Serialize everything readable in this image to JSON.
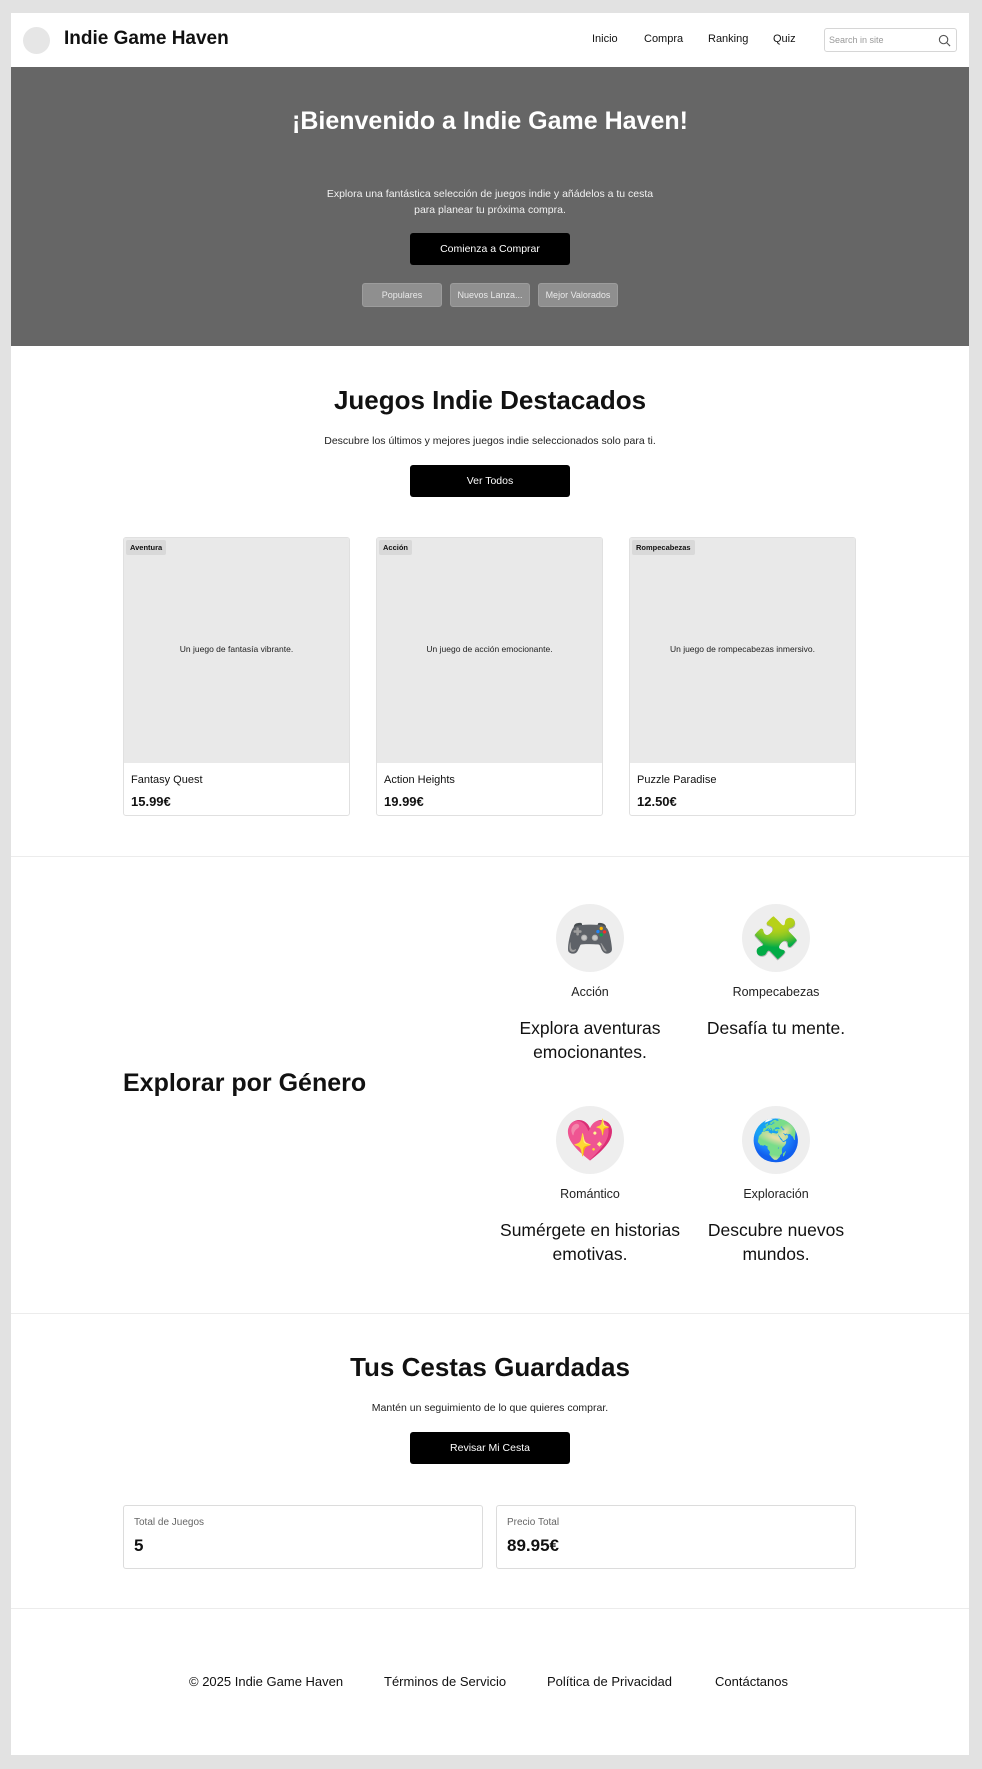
{
  "header": {
    "brand": "Indie Game Haven",
    "nav": [
      "Inicio",
      "Compra",
      "Ranking",
      "Quiz"
    ],
    "search_placeholder": "Search in site"
  },
  "hero": {
    "title": "¡Bienvenido a Indie Game Haven!",
    "subtitle": "Explora una fantástica selección de juegos indie y añádelos a tu cesta para planear tu próxima compra.",
    "cta": "Comienza a Comprar",
    "filters": [
      "Populares",
      "Nuevos Lanza...",
      "Mejor Valorados"
    ]
  },
  "featured": {
    "title": "Juegos Indie Destacados",
    "subtitle": "Descubre los últimos y mejores juegos indie seleccionados solo para ti.",
    "cta": "Ver Todos",
    "games": [
      {
        "badge": "Aventura",
        "description": "Un juego de fantasía vibrante.",
        "name": "Fantasy Quest",
        "price": "15.99€"
      },
      {
        "badge": "Acción",
        "description": "Un juego de acción emocionante.",
        "name": "Action Heights",
        "price": "19.99€"
      },
      {
        "badge": "Rompecabezas",
        "description": "Un juego de rompecabezas inmersivo.",
        "name": "Puzzle Paradise",
        "price": "12.50€"
      }
    ]
  },
  "genres": {
    "title": "Explorar por Género",
    "items": [
      {
        "icon": "🎮",
        "icon_name": "game-controller-icon",
        "name": "Acción",
        "description": "Explora aventuras emocionantes."
      },
      {
        "icon": "🧩",
        "icon_name": "puzzle-piece-icon",
        "name": "Rompecabezas",
        "description": "Desafía tu mente."
      },
      {
        "icon": "💖",
        "icon_name": "sparkling-heart-icon",
        "name": "Romántico",
        "description": "Sumérgete en historias emotivas."
      },
      {
        "icon": "🌍",
        "icon_name": "globe-icon",
        "name": "Exploración",
        "description": "Descubre nuevos mundos."
      }
    ]
  },
  "baskets": {
    "title": "Tus Cestas Guardadas",
    "subtitle": "Mantén un seguimiento de lo que quieres comprar.",
    "cta": "Revisar Mi Cesta",
    "stats": [
      {
        "label": "Total de Juegos",
        "value": "5"
      },
      {
        "label": "Precio Total",
        "value": "89.95€"
      }
    ]
  },
  "footer": {
    "copyright": "© 2025 Indie Game Haven",
    "links": [
      "Términos de Servicio",
      "Política de Privacidad",
      "Contáctanos"
    ]
  }
}
